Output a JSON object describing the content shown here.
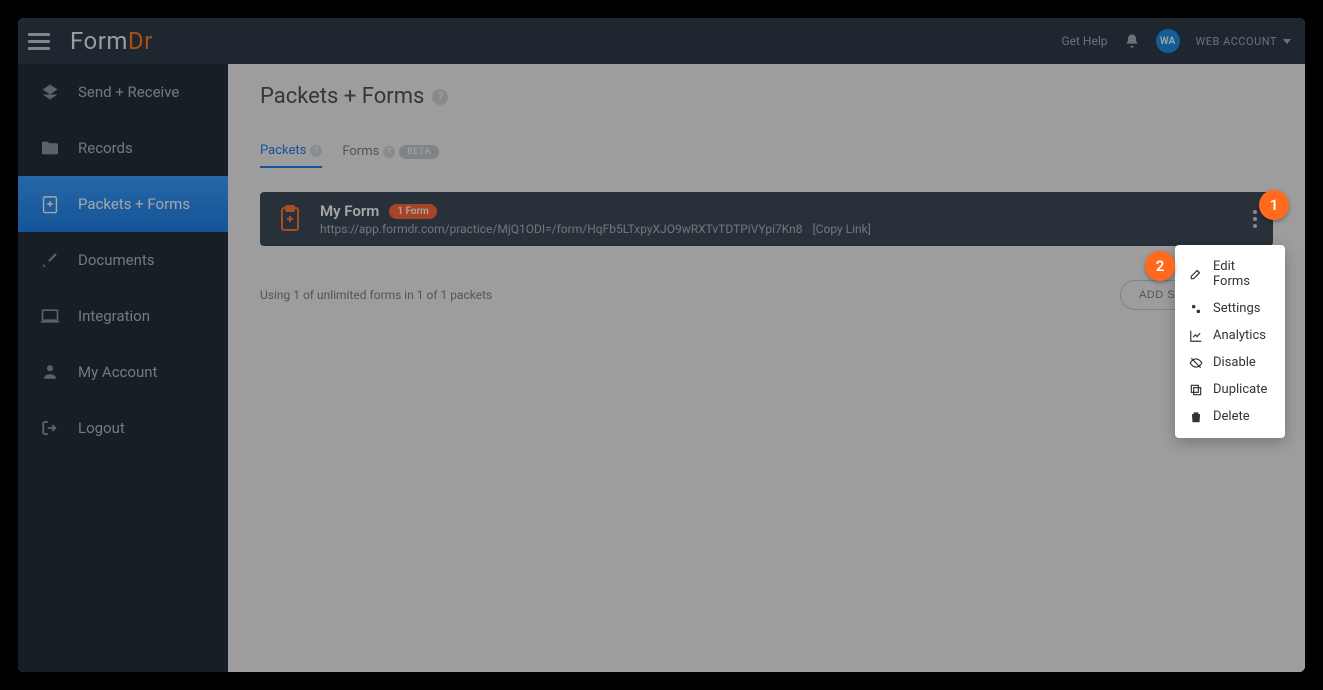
{
  "header": {
    "logo_main": "Form",
    "logo_accent": "Dr",
    "get_help": "Get Help",
    "avatar_initials": "WA",
    "account_label": "WEB ACCOUNT"
  },
  "sidebar": {
    "items": [
      {
        "label": "Send + Receive",
        "icon": "send-receive-icon"
      },
      {
        "label": "Records",
        "icon": "folder-icon"
      },
      {
        "label": "Packets + Forms",
        "icon": "packet-icon"
      },
      {
        "label": "Documents",
        "icon": "document-edit-icon"
      },
      {
        "label": "Integration",
        "icon": "laptop-icon"
      },
      {
        "label": "My Account",
        "icon": "user-icon"
      },
      {
        "label": "Logout",
        "icon": "logout-icon"
      }
    ]
  },
  "page": {
    "title": "Packets + Forms"
  },
  "tabs": {
    "packets": "Packets",
    "forms": "Forms",
    "beta": "BETA"
  },
  "packet": {
    "title": "My Form",
    "form_count": "1 Form",
    "url": "https://app.formdr.com/practice/MjQ1ODI=/form/HqFb5LTxpyXJO9wRXTvTDTPiVYpi7Kn8",
    "copy_link": "[Copy Link]"
  },
  "footer": {
    "usage": "Using 1 of unlimited forms in 1 of 1 packets",
    "add_synced": "ADD SYNCED FORM"
  },
  "menu": {
    "edit_forms": "Edit Forms",
    "settings": "Settings",
    "analytics": "Analytics",
    "disable": "Disable",
    "duplicate": "Duplicate",
    "delete": "Delete"
  },
  "annotations": {
    "one": "1",
    "two": "2"
  }
}
